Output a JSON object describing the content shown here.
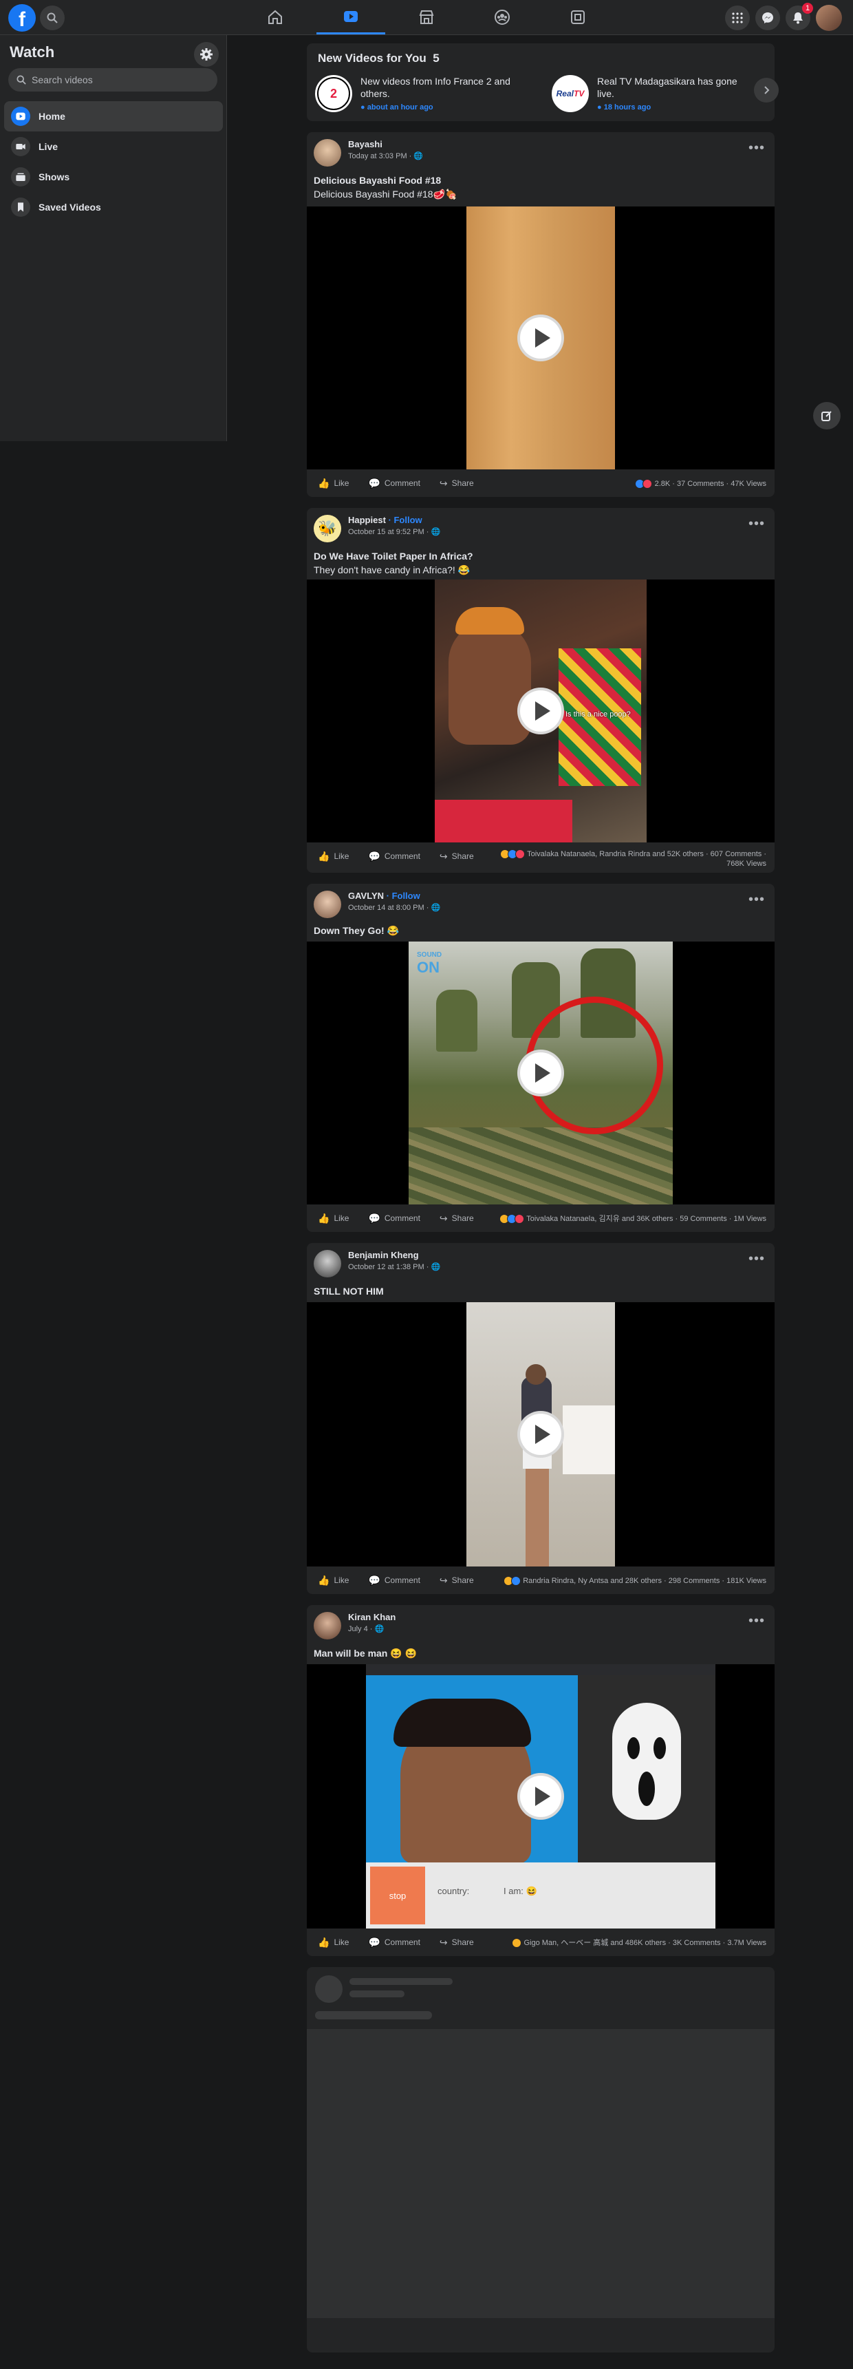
{
  "topbar": {
    "logo_letter": "f",
    "notifications_count": "1",
    "nav_tabs": [
      {
        "icon": "home-icon"
      },
      {
        "icon": "watch-icon",
        "active": true
      },
      {
        "icon": "marketplace-icon"
      },
      {
        "icon": "groups-icon"
      },
      {
        "icon": "gaming-icon"
      }
    ]
  },
  "sidebar": {
    "title": "Watch",
    "search_placeholder": "Search videos",
    "items": [
      {
        "label": "Home",
        "active": true
      },
      {
        "label": "Live"
      },
      {
        "label": "Shows"
      },
      {
        "label": "Saved Videos"
      }
    ]
  },
  "new_videos": {
    "title": "New Videos for You",
    "count": "5",
    "items": [
      {
        "text": "New videos from Info France 2 and others.",
        "time": "about an hour ago",
        "logo": "2 info"
      },
      {
        "text": "Real TV Madagasikara has gone live.",
        "time": "18 hours ago",
        "logo": "RealTV"
      }
    ]
  },
  "posts": [
    {
      "author": "Bayashi",
      "follow": "",
      "time": "Today at 3:03 PM · ",
      "title": "Delicious Bayashi Food #18",
      "description": "Delicious Bayashi Food #18🥩🍖",
      "stats": "2.8K · 37 Comments · 47K Views",
      "stats2": ""
    },
    {
      "author": "Happiest",
      "follow": " · Follow",
      "time": "October 15 at 9:52 PM · ",
      "title": "Do We Have Toilet Paper In Africa?",
      "description": "They don't have candy in Africa?! 😂",
      "stats": "Toivalaka Natanaela, Randria Rindra and 52K others · 607 Comments ·",
      "stats2": "768K Views"
    },
    {
      "author": "GAVLYN",
      "follow": " · Follow",
      "time": "October 14 at 8:00 PM · ",
      "title": "Down They Go! 😂",
      "description": "",
      "stats": "Toivalaka Natanaela, 김지유 and 36K others · 59 Comments · 1M Views",
      "stats2": ""
    },
    {
      "author": "Benjamin Kheng",
      "follow": "",
      "time": "October 12 at 1:38 PM · ",
      "title": "STILL NOT HIM",
      "description": "",
      "stats": "Randria Rindra, Ny Antsa and 28K others · 298 Comments · 181K Views",
      "stats2": ""
    },
    {
      "author": "Kiran Khan",
      "follow": "",
      "time": "July 4 · ",
      "title": "Man will be man 😆 😆",
      "description": "",
      "stats": "Gigo Man, ヘーベー 高城 and 486K others · 3K Comments · 3.7M Views",
      "stats2": ""
    }
  ],
  "actions": {
    "like": "Like",
    "comment": "Comment",
    "share": "Share"
  },
  "kiran_overlay": {
    "stop": "stop",
    "country": "country: ",
    "iam": "I am: 😆"
  },
  "gavlyn_overlay": {
    "sound": "SOUND",
    "on": "ON"
  },
  "happiest_overlay": {
    "caption": "Is this a nice poop?"
  },
  "colors": {
    "accent": "#2d88ff",
    "brand": "#1877f2",
    "background": "#18191a",
    "surface": "#242526"
  }
}
